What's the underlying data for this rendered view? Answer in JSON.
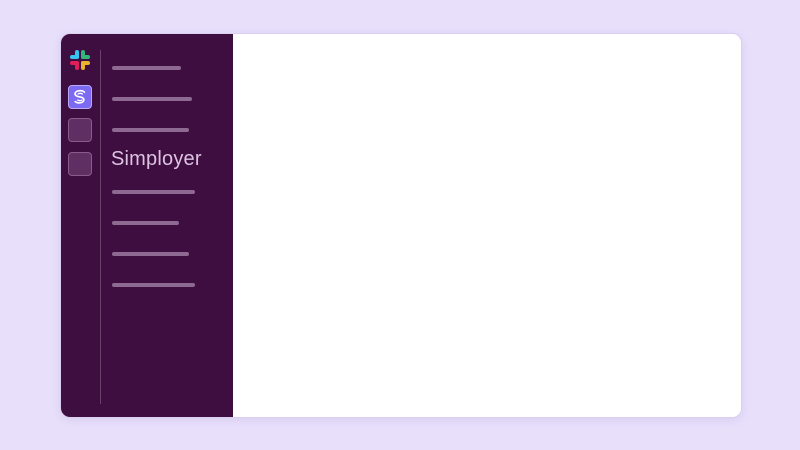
{
  "app": {
    "name": "Slack",
    "logo_icon": "slack-logo-icon"
  },
  "workspaces": [
    {
      "id": "simployer",
      "icon": "simployer-logo-icon",
      "active": true
    },
    {
      "id": "workspace-2",
      "icon": "empty-workspace-tile",
      "active": false
    },
    {
      "id": "workspace-3",
      "icon": "empty-workspace-tile",
      "active": false
    }
  ],
  "sidebar": {
    "workspace_name": "Simployer",
    "placeholder_lines_above": 3,
    "placeholder_lines_below": 4
  },
  "colors": {
    "background": "#e8e0fb",
    "sidebar": "#3f0e40",
    "active_workspace": "#7c6af2",
    "placeholder": "#8e6991",
    "workspace_name_text": "#dcc3e2"
  }
}
